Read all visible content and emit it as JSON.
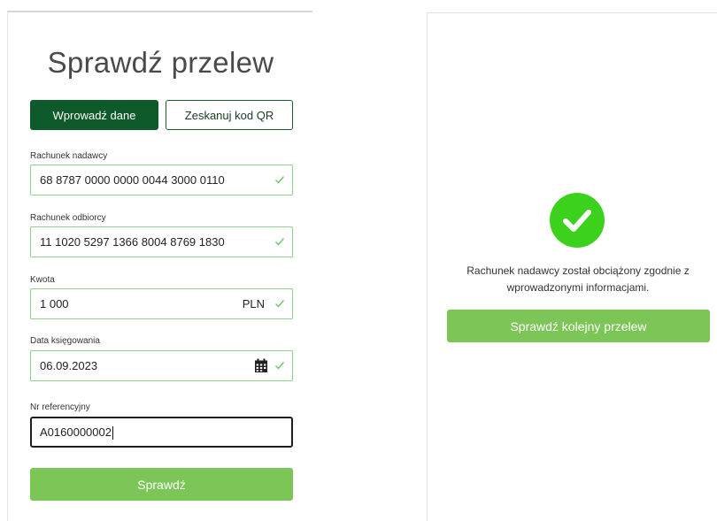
{
  "form": {
    "title": "Sprawdź przelew",
    "tabs": [
      {
        "label": "Wprowadź dane",
        "active": true
      },
      {
        "label": "Zeskanuj kod QR",
        "active": false
      }
    ],
    "fields": {
      "sender_account": {
        "label": "Rachunek nadawcy",
        "value": "68 8787 0000 0000 0044 3000 0110",
        "valid": true
      },
      "recipient_account": {
        "label": "Rachunek odbiorcy",
        "value": "11 1020 5297 1366 8004 8769 1830",
        "valid": true
      },
      "amount": {
        "label": "Kwota",
        "value": "1 000",
        "currency": "PLN",
        "valid": true
      },
      "booking_date": {
        "label": "Data księgowania",
        "value": "06.09.2023",
        "valid": true
      },
      "reference": {
        "label": "Nr referencyjny",
        "value": "A0160000002",
        "focused": true
      }
    },
    "submit_label": "Sprawdź"
  },
  "result": {
    "status_icon": "check-circle-icon",
    "message_line1": "Rachunek nadawcy został obciążony zgodnie z",
    "message_line2": "wprowadzonymi informacjami.",
    "again_label": "Sprawdź kolejny przelew"
  },
  "colors": {
    "primary_dark": "#0f5a2a",
    "accent_green": "#7cc658",
    "success_green": "#3cd11d",
    "valid_border": "#8fd18f"
  }
}
